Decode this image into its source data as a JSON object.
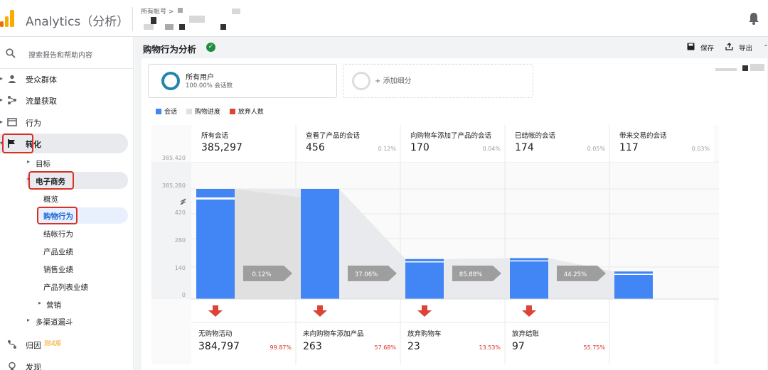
{
  "app": {
    "title": "Analytics（分析）",
    "account_path": "所有帐号 >"
  },
  "sidebar": {
    "search_placeholder": "搜索报告和帮助内容",
    "items": [
      {
        "label": "受众群体"
      },
      {
        "label": "流量获取"
      },
      {
        "label": "行为"
      },
      {
        "label": "转化"
      }
    ],
    "conversions_sub": {
      "goals": "目标",
      "ecommerce": "电子商务"
    },
    "ecommerce_sub": [
      "概览",
      "购物行为",
      "结帐行为",
      "产品业绩",
      "销售业绩",
      "产品列表业绩"
    ],
    "marketing": "营销",
    "multichannel": "多渠道漏斗",
    "attribution": "归因",
    "attribution_badge": "测试版",
    "discover": "发现"
  },
  "page": {
    "title": "购物行为分析",
    "save_label": "保存",
    "export_label": "导出"
  },
  "segments": {
    "all_users": "所有用户",
    "all_users_pct": "100.00% 会话数",
    "add_segment": "+ 添加细分"
  },
  "legend": {
    "sessions": "会话",
    "progress": "购物进度",
    "abandon": "放弃人数"
  },
  "colors": {
    "sessions": "#4285f4",
    "progress": "#e0e0e0",
    "abandon": "#db4437",
    "arrow": "#9e9e9e"
  },
  "chart_data": {
    "type": "bar",
    "title": "",
    "y_ticks_upper": [
      "385,420",
      "385,280"
    ],
    "y_ticks_lower": [
      "420",
      "280",
      "140",
      "0"
    ],
    "stages": [
      {
        "label": "所有会话",
        "value": 385297,
        "display": "385,297",
        "pct": ""
      },
      {
        "label": "查看了产品的会话",
        "value": 456,
        "display": "456",
        "pct": "0.12%"
      },
      {
        "label": "向购物车添加了产品的会话",
        "value": 170,
        "display": "170",
        "pct": "0.04%"
      },
      {
        "label": "已结帐的会话",
        "value": 174,
        "display": "174",
        "pct": "0.05%"
      },
      {
        "label": "带来交易的会话",
        "value": 117,
        "display": "117",
        "pct": "0.03%"
      }
    ],
    "progress_rates": [
      "0.12%",
      "37.06%",
      "85.88%",
      "44.25%"
    ],
    "abandon": [
      {
        "label": "无购物活动",
        "value": 384797,
        "display": "384,797",
        "pct": "99.87%"
      },
      {
        "label": "未向购物车添加产品",
        "value": 263,
        "display": "263",
        "pct": "57.68%"
      },
      {
        "label": "放弃购物车",
        "value": 23,
        "display": "23",
        "pct": "13.53%"
      },
      {
        "label": "放弃结账",
        "value": 97,
        "display": "97",
        "pct": "55.75%"
      }
    ]
  }
}
